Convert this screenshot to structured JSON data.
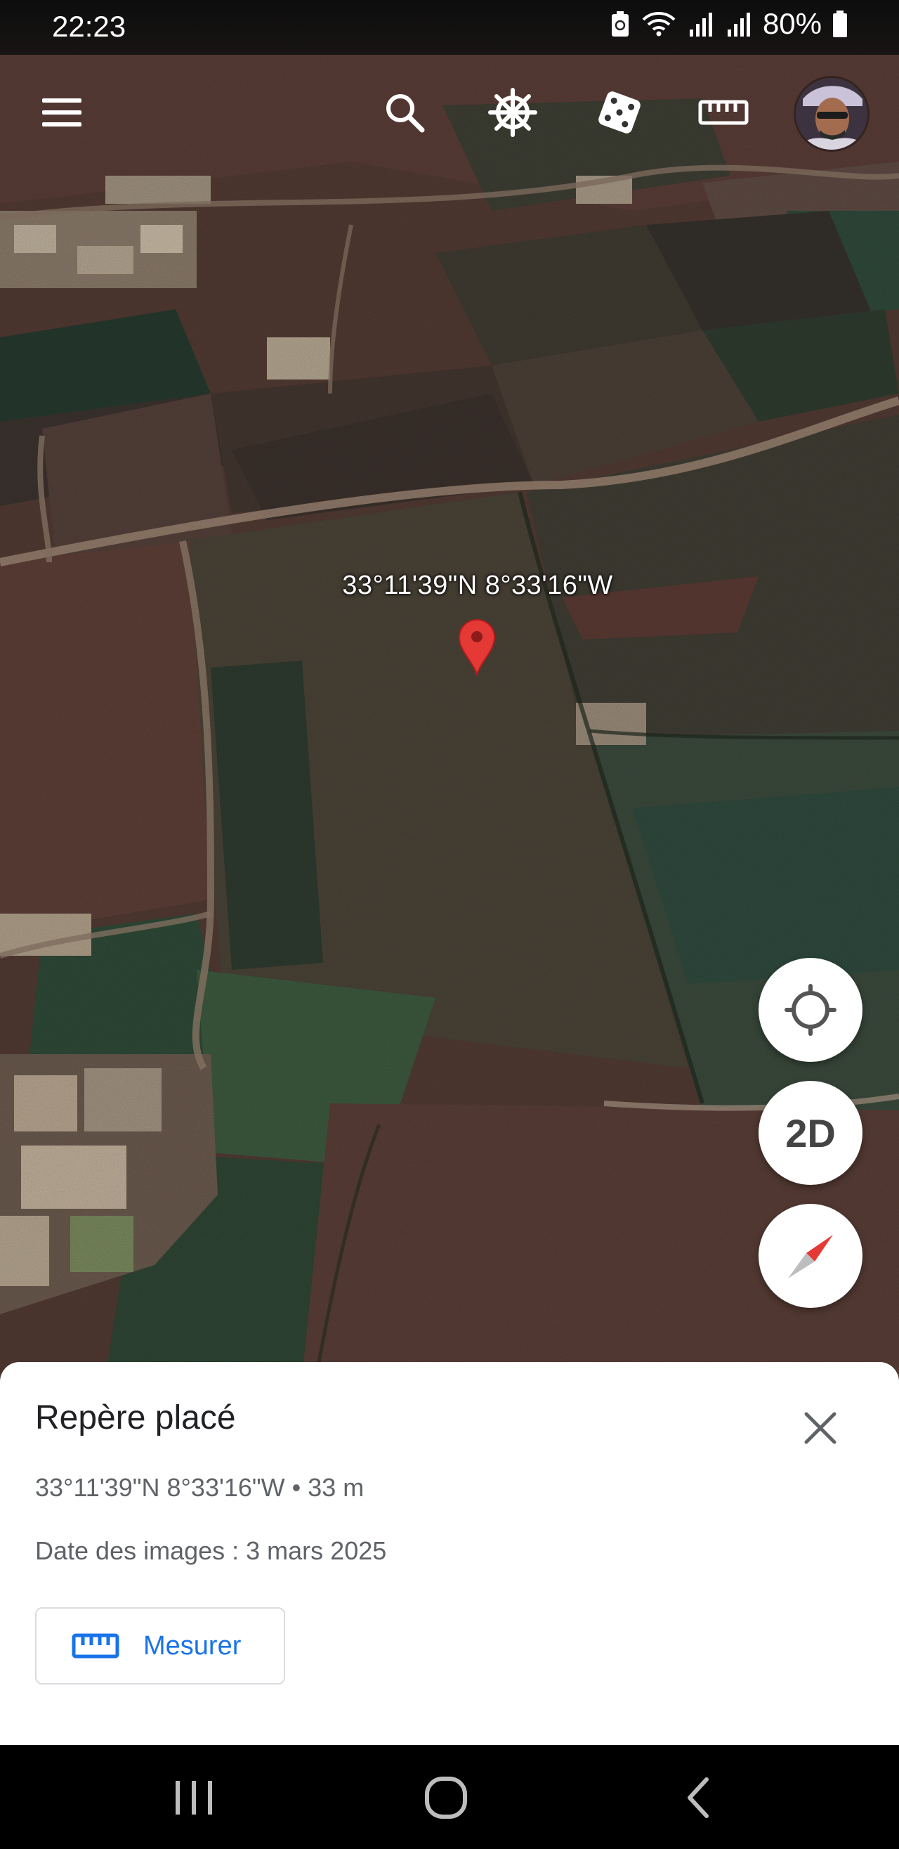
{
  "status_bar": {
    "time": "22:23",
    "battery": "80%",
    "icons": [
      "battery-saver-icon",
      "wifi-icon",
      "signal-icon",
      "signal-icon",
      "battery-icon"
    ]
  },
  "toolbar": {
    "icons": [
      "menu-icon",
      "search-icon",
      "voyager-icon",
      "dice-icon",
      "ruler-icon",
      "avatar"
    ]
  },
  "map": {
    "pin_label": "33°11'39\"N 8°33'16\"W",
    "pin_color": "#e53935"
  },
  "map_controls": {
    "view_mode": "2D",
    "icons": [
      "my-location-icon",
      "compass-icon"
    ]
  },
  "placemark_sheet": {
    "title": "Repère placé",
    "coordinates": "33°11'39\"N 8°33'16\"W • 33 m",
    "imagery_date": "Date des images : 3 mars 2025",
    "measure_label": "Mesurer",
    "accent": "#1a73e8"
  },
  "nav_bar": {
    "icons": [
      "recents-icon",
      "home-icon",
      "back-icon"
    ]
  }
}
